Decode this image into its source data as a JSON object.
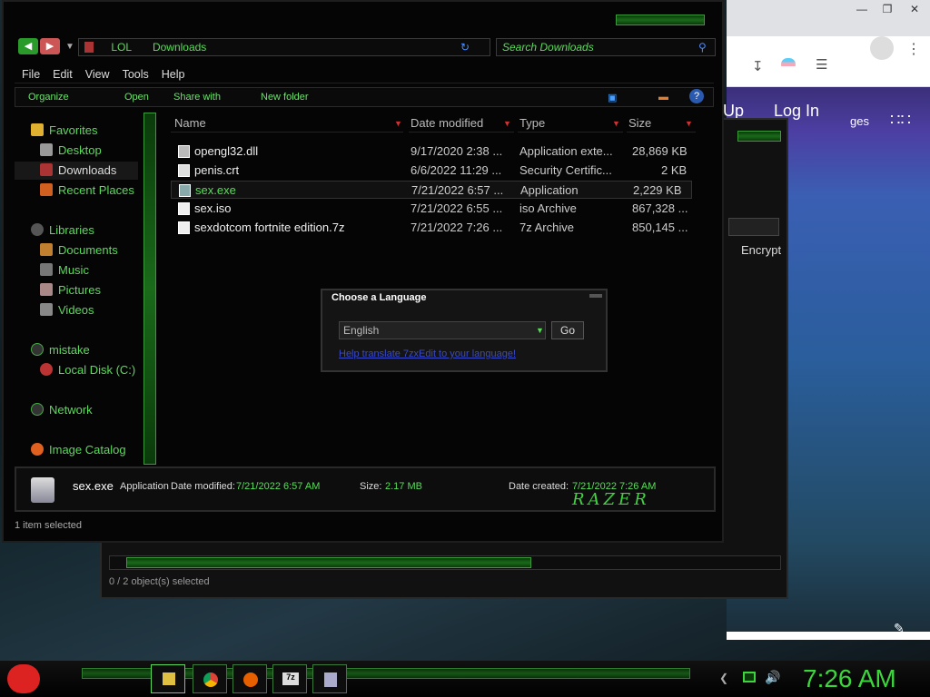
{
  "explorer": {
    "address": {
      "root": "LOL",
      "current": "Downloads"
    },
    "search_placeholder": "Search Downloads",
    "menu": [
      "File",
      "Edit",
      "View",
      "Tools",
      "Help"
    ],
    "commands": {
      "organize": "Organize",
      "open": "Open",
      "share": "Share with",
      "new_folder": "New folder"
    },
    "nav": {
      "favorites": "Favorites",
      "desktop": "Desktop",
      "downloads": "Downloads",
      "recent": "Recent Places",
      "libraries": "Libraries",
      "documents": "Documents",
      "music": "Music",
      "pictures": "Pictures",
      "videos": "Videos",
      "mistake": "mistake",
      "local_disk": "Local Disk (C:)",
      "network": "Network",
      "image_catalog": "Image Catalog"
    },
    "columns": {
      "name": "Name",
      "date": "Date modified",
      "type": "Type",
      "size": "Size"
    },
    "files": [
      {
        "name": "opengl32.dll",
        "date": "9/17/2020 2:38 ...",
        "type": "Application exte...",
        "size": "28,869 KB"
      },
      {
        "name": "penis.crt",
        "date": "6/6/2022 11:29 ...",
        "type": "Security Certific...",
        "size": "2 KB"
      },
      {
        "name": "sex.exe",
        "date": "7/21/2022 6:57 ...",
        "type": "Application",
        "size": "2,229 KB"
      },
      {
        "name": "sex.iso",
        "date": "7/21/2022 6:55 ...",
        "type": "iso Archive",
        "size": "867,328 ..."
      },
      {
        "name": "sexdotcom fortnite edition.7z",
        "date": "7/21/2022 7:26 ...",
        "type": "7z Archive",
        "size": "850,145 ..."
      }
    ],
    "details": {
      "name": "sex.exe",
      "kind": "Application",
      "date_label": "Date modified:",
      "date": "7/21/2022 6:57 AM",
      "size_label": "Size:",
      "size": "2.17 MB",
      "created_label": "Date created:",
      "created": "7/21/2022 7:26 AM",
      "logo": "RAZER"
    },
    "status": "1 item selected"
  },
  "dialog": {
    "title": "Choose a Language",
    "selected": "English",
    "go": "Go",
    "link": "Help translate 7zxEdit to your language!"
  },
  "back_window": {
    "status": "0 / 2 object(s) selected",
    "col": "Encrypt"
  },
  "browser": {
    "signup": "Up",
    "login": "Log In",
    "ges": "ges"
  },
  "taskbar": {
    "clock": "7:26 AM",
    "accent": "#3cd63c"
  }
}
